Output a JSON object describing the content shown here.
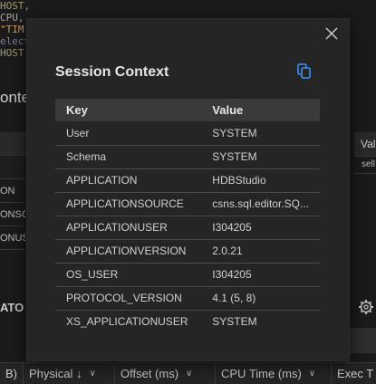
{
  "background": {
    "code_lines": [
      {
        "text": "HOST,",
        "color": "#a39b6f"
      },
      {
        "text": "CPU,",
        "color": "#a7a7a7"
      },
      {
        "text": "\"TIM",
        "color": "#c9a26b"
      },
      {
        "text": "elect",
        "color": "#8a7eab"
      },
      {
        "text": "HOST",
        "color": "#a39b6f"
      }
    ],
    "title_fragment": "ontex",
    "left_rows": [
      "",
      "ON",
      "ONSOU",
      "ONUSE"
    ],
    "right_header": "Val",
    "right_cell": "sell",
    "section_fragment": "ATO",
    "column_headers": [
      {
        "label": "B)",
        "chevron": ""
      },
      {
        "label": "Physical ↓",
        "chevron": "∨"
      },
      {
        "label": "Offset (ms)",
        "chevron": "∨"
      },
      {
        "label": "CPU Time (ms)",
        "chevron": "∨"
      },
      {
        "label": "Exec T",
        "chevron": ""
      }
    ]
  },
  "modal": {
    "title": "Session Context",
    "close_icon": "close-icon",
    "copy_icon": "copy-icon",
    "accent_color": "#3794ff",
    "table": {
      "headers": {
        "key": "Key",
        "value": "Value"
      },
      "rows": [
        {
          "key": "User",
          "value": "SYSTEM"
        },
        {
          "key": "Schema",
          "value": "SYSTEM"
        },
        {
          "key": "APPLICATION",
          "value": "HDBStudio"
        },
        {
          "key": "APPLICATIONSOURCE",
          "value": "csns.sql.editor.SQ..."
        },
        {
          "key": "APPLICATIONUSER",
          "value": "I304205"
        },
        {
          "key": "APPLICATIONVERSION",
          "value": "2.0.21"
        },
        {
          "key": "OS_USER",
          "value": "I304205"
        },
        {
          "key": "PROTOCOL_VERSION",
          "value": "4.1 (5, 8)"
        },
        {
          "key": "XS_APPLICATIONUSER",
          "value": "SYSTEM"
        }
      ]
    }
  }
}
